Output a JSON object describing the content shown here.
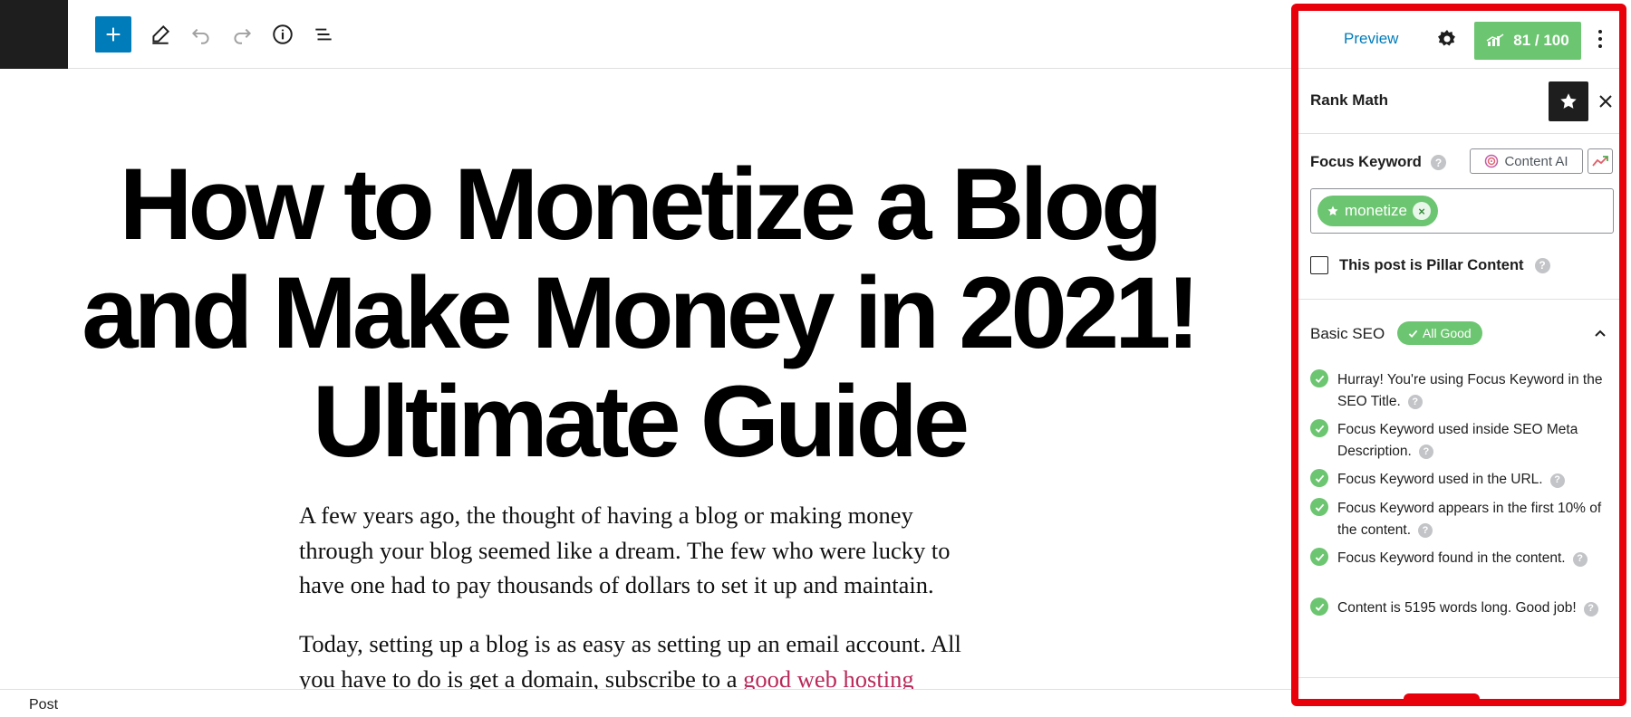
{
  "toolbar": {
    "add_label": "+",
    "tools": [
      "add-block",
      "edit",
      "undo",
      "redo",
      "details",
      "list-view"
    ]
  },
  "post": {
    "title": "How to Monetize a Blog and Make Money in 2021! Ultimate Guide",
    "para1": "A few years ago, the thought of having a blog or making money through your blog seemed like a dream. The few who were lucky to have one had to pay thousands of dollars to set it up and maintain.",
    "para2_before_link": "Today, setting up a blog is as easy as setting up an email account. All you have to do is get a domain, subscribe to a ",
    "para2_link": "good web hosting"
  },
  "statusbar": {
    "label": "Post"
  },
  "header": {
    "preview_label": "Preview",
    "score_label": "81 / 100"
  },
  "plugin": {
    "name": "Rank Math",
    "focus_keyword_label": "Focus Keyword",
    "content_ai_label": "Content AI",
    "keyword": "monetize",
    "pillar_label": "This post is Pillar Content",
    "basic_seo_label": "Basic SEO",
    "all_good_label": "All Good",
    "help_glyph": "?",
    "remove_glyph": "×",
    "checks": [
      "Hurray! You're using Focus Keyword in the SEO Title.",
      "Focus Keyword used inside SEO Meta Description.",
      "Focus Keyword used in the URL.",
      "Focus Keyword appears in the first 10% of the content.",
      "Focus Keyword found in the content.",
      "Content is 5195 words long. Good job!"
    ]
  },
  "colors": {
    "accent_blue": "#007cba",
    "score_green": "#6cc570",
    "highlight_red": "#e8000b",
    "link_red": "#b9295a"
  }
}
